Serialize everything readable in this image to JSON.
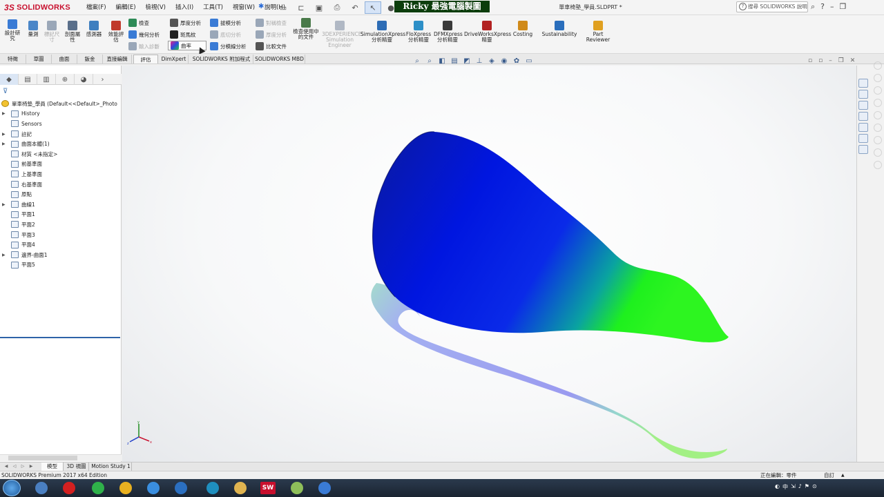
{
  "app": {
    "logo_prefix": "3S",
    "logo_name": "SOLIDWORKS",
    "menus": [
      "檔案(F)",
      "編輯(E)",
      "檢視(V)",
      "插入(I)",
      "工具(T)",
      "視窗(W)",
      "說明(H)"
    ],
    "banner": "Ricky 最強電腦製圖",
    "doc_title": "單車椅墊_學員.SLDPRT *",
    "search_placeholder": "搜尋 SOLIDWORKS 說明"
  },
  "ribbon": {
    "large_buttons": [
      {
        "label": "設計研究",
        "color": "#3a7bd5",
        "dim": false
      },
      {
        "label": "量測",
        "color": "#4a86c8",
        "dim": false
      },
      {
        "label": "標記尺寸",
        "color": "#9aa7b8",
        "dim": true
      },
      {
        "label": "剖面屬性",
        "color": "#5a6f8a",
        "dim": false
      },
      {
        "label": "感測器",
        "color": "#3f7fbf",
        "dim": false
      },
      {
        "label": "效能評估",
        "color": "#c0392b",
        "dim": false
      }
    ],
    "eval_col1": [
      {
        "label": "檢查",
        "color": "#2e8b57",
        "dim": false
      },
      {
        "label": "幾何分析",
        "color": "#3a7bd5",
        "dim": false
      },
      {
        "label": "輸入診斷",
        "color": "#9aa7b8",
        "dim": true
      }
    ],
    "eval_col2": [
      {
        "label": "厚度分析",
        "color": "#555555",
        "dim": false
      },
      {
        "label": "斑馬紋",
        "color": "#222222",
        "dim": false
      },
      {
        "label": "曲率",
        "color": "#7b3fbf",
        "dim": false,
        "highlight": true
      }
    ],
    "eval_col3": [
      {
        "label": "拔模分析",
        "color": "#3a7bd5",
        "dim": false
      },
      {
        "label": "底切分析",
        "color": "#9aa7b8",
        "dim": true
      },
      {
        "label": "分模線分析",
        "color": "#3a7bd5",
        "dim": false
      }
    ],
    "eval_col4": [
      {
        "label": "對稱檢查",
        "color": "#9aa7b8",
        "dim": true
      },
      {
        "label": "厚度分析",
        "color": "#9aa7b8",
        "dim": true
      },
      {
        "label": "比較文件",
        "color": "#555555",
        "dim": false
      }
    ],
    "check_active_doc": "檢查使用中的文件",
    "addins": [
      {
        "label": "3DEXPERIENCE Simulation Engineer",
        "dim": true,
        "color": "#b0b8c4"
      },
      {
        "label": "SimulationXpress 分析精靈",
        "dim": false,
        "color": "#2d6cb5"
      },
      {
        "label": "FloXpress 分析精靈",
        "dim": false,
        "color": "#2d8fc7"
      },
      {
        "label": "DFMXpress 分析精靈",
        "dim": false,
        "color": "#3a3a3a"
      },
      {
        "label": "DriveWorksXpress 精靈",
        "dim": false,
        "color": "#b22222"
      },
      {
        "label": "Costing",
        "dim": false,
        "color": "#d08a1a"
      },
      {
        "label": "Sustainability",
        "dim": false,
        "color": "#2a6ebc"
      },
      {
        "label": "Part Reviewer",
        "dim": false,
        "color": "#e0a020"
      }
    ]
  },
  "tabs": [
    "特徵",
    "草圖",
    "曲面",
    "鈑金",
    "直接編輯",
    "評估",
    "DimXpert",
    "SOLIDWORKS 附加程式",
    "SOLIDWORKS MBD"
  ],
  "active_tab": "評估",
  "tree": {
    "root": "單車椅墊_學員 (Default<<Default>_Photo",
    "items": [
      {
        "label": "History",
        "expand": true
      },
      {
        "label": "Sensors",
        "expand": false
      },
      {
        "label": "註記",
        "expand": true
      },
      {
        "label": "曲面本體(1)",
        "expand": true
      },
      {
        "label": "材質 <未指定>",
        "expand": false
      },
      {
        "label": "前基準面",
        "expand": false
      },
      {
        "label": "上基準面",
        "expand": false
      },
      {
        "label": "右基準面",
        "expand": false
      },
      {
        "label": "原點",
        "expand": false
      },
      {
        "label": "曲線1",
        "expand": true
      },
      {
        "label": "平面1",
        "expand": false
      },
      {
        "label": "平面2",
        "expand": false
      },
      {
        "label": "平面3",
        "expand": false
      },
      {
        "label": "平面4",
        "expand": false
      },
      {
        "label": "邊界-曲面1",
        "expand": true
      },
      {
        "label": "平面5",
        "expand": false
      }
    ]
  },
  "bottom_tabs": [
    "模型",
    "3D 視圖",
    "Motion Study 1"
  ],
  "status": {
    "left": "SOLIDWORKS Premium 2017 x64 Edition",
    "editing": "正在編輯：零件",
    "units": "自訂"
  },
  "taskbar": {
    "apps": [
      {
        "color": "#4a7fc1",
        "text": ""
      },
      {
        "color": "#d42020",
        "text": ""
      },
      {
        "color": "#2fb14a",
        "text": ""
      },
      {
        "color": "#e8b020",
        "text": ""
      },
      {
        "color": "#3a8ee0",
        "text": ""
      },
      {
        "color": "#2b6fc0",
        "text": ""
      },
      {
        "color": "#1f8fbf",
        "text": ""
      },
      {
        "color": "#e0b450",
        "text": ""
      },
      {
        "color": "#c8102e",
        "text": "SW"
      },
      {
        "color": "#8fbf5a",
        "text": ""
      },
      {
        "color": "#3a7bd5",
        "text": ""
      }
    ],
    "tray": "中"
  }
}
